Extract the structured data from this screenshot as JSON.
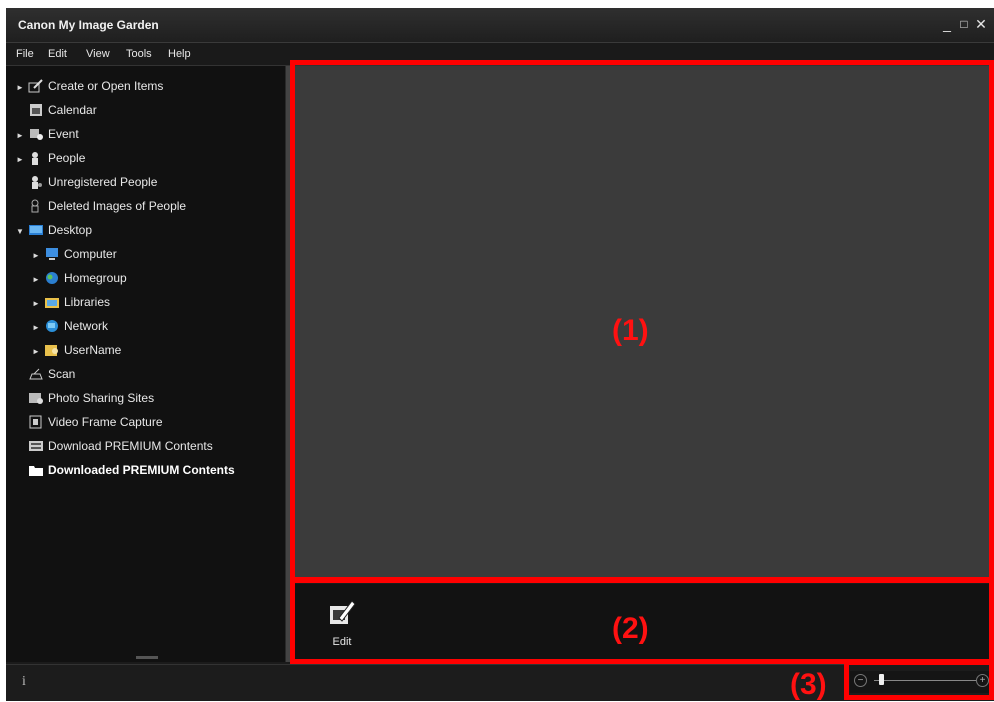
{
  "window": {
    "title": "Canon My Image Garden",
    "minimize": "_",
    "maximize": "□",
    "close": "✕"
  },
  "menu": [
    "File",
    "Edit",
    "View",
    "Tools",
    "Help"
  ],
  "sidebar": {
    "items": [
      {
        "label": "Create or Open Items",
        "icon": "create-open-icon",
        "arrow": "►"
      },
      {
        "label": "Calendar",
        "icon": "calendar-icon",
        "arrow": ""
      },
      {
        "label": "Event",
        "icon": "event-icon",
        "arrow": "►"
      },
      {
        "label": "People",
        "icon": "people-icon",
        "arrow": "►"
      },
      {
        "label": "Unregistered People",
        "icon": "unregistered-people-icon",
        "arrow": ""
      },
      {
        "label": "Deleted Images of People",
        "icon": "deleted-people-icon",
        "arrow": ""
      },
      {
        "label": "Desktop",
        "icon": "desktop-icon",
        "arrow": "▼"
      },
      {
        "label": "Computer",
        "icon": "computer-icon",
        "arrow": "►"
      },
      {
        "label": "Homegroup",
        "icon": "homegroup-icon",
        "arrow": "►"
      },
      {
        "label": "Libraries",
        "icon": "libraries-icon",
        "arrow": "►"
      },
      {
        "label": "Network",
        "icon": "network-icon",
        "arrow": "►"
      },
      {
        "label": "UserName",
        "icon": "user-folder-icon",
        "arrow": "►"
      },
      {
        "label": "Scan",
        "icon": "scan-icon",
        "arrow": ""
      },
      {
        "label": "Photo Sharing Sites",
        "icon": "photo-sharing-icon",
        "arrow": ""
      },
      {
        "label": "Video Frame Capture",
        "icon": "video-frame-icon",
        "arrow": ""
      },
      {
        "label": "Download PREMIUM Contents",
        "icon": "download-premium-icon",
        "arrow": ""
      },
      {
        "label": "Downloaded PREMIUM Contents",
        "icon": "folder-icon",
        "arrow": ""
      }
    ]
  },
  "annotations": {
    "area1": "(1)",
    "area2": "(2)",
    "area3": "(3)"
  },
  "actionbar": {
    "edit_label": "Edit"
  },
  "statusbar": {
    "info": "i",
    "zoom_level": 0.05
  },
  "colors": {
    "annotation": "#ff0000",
    "background": "#1b1b1b",
    "main": "#3b3b3b"
  }
}
